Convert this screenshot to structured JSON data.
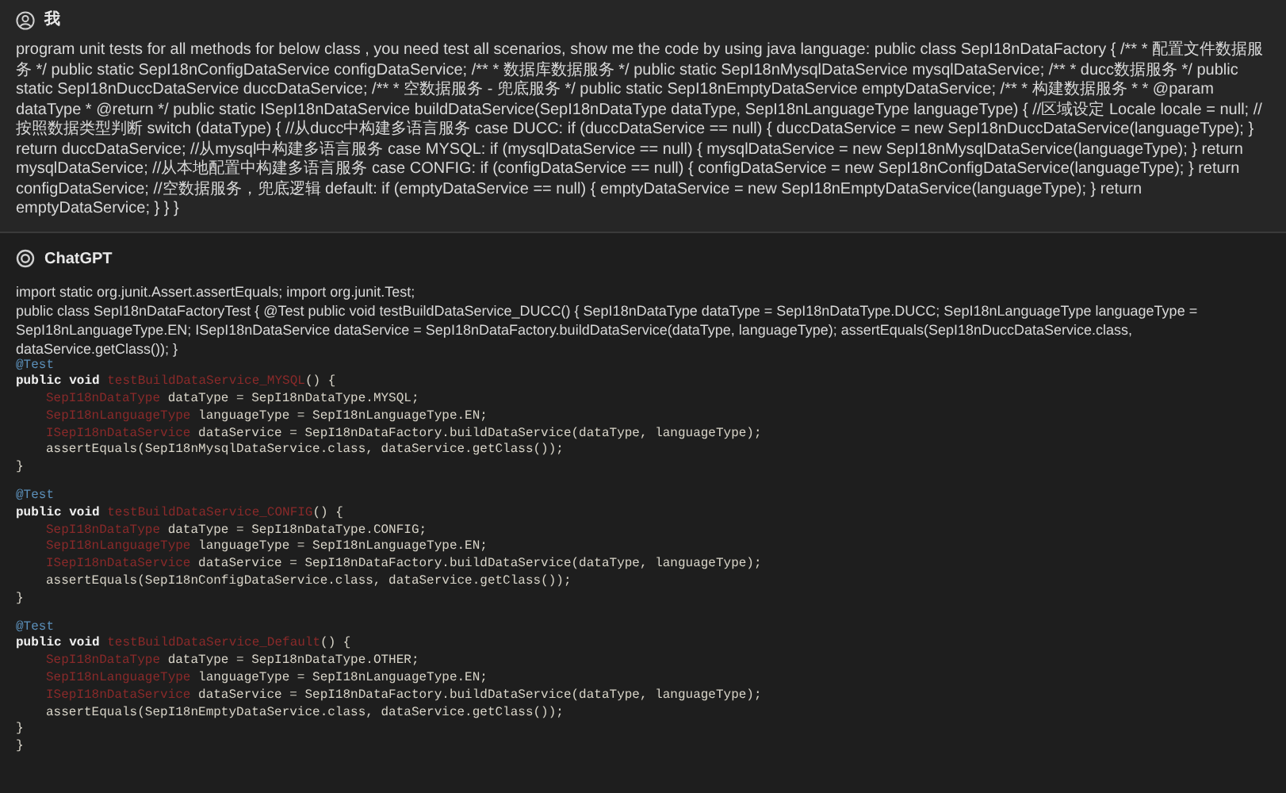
{
  "user_message": {
    "author": "我",
    "text": "program unit tests for all methods for below class , you need test all scenarios, show me the code by using java language: public class SepI18nDataFactory { /** * 配置文件数据服务 */ public static SepI18nConfigDataService configDataService; /** * 数据库数据服务 */ public static SepI18nMysqlDataService mysqlDataService; /** * ducc数据服务 */ public static SepI18nDuccDataService duccDataService; /** * 空数据服务 - 兜底服务 */ public static SepI18nEmptyDataService emptyDataService; /** * 构建数据服务 * * @param dataType * @return */ public static ISepI18nDataService buildDataService(SepI18nDataType dataType, SepI18nLanguageType languageType) { //区域设定 Locale locale = null; //按照数据类型判断 switch (dataType) { //从ducc中构建多语言服务 case DUCC: if (duccDataService == null) { duccDataService = new SepI18nDuccDataService(languageType); } return duccDataService; //从mysql中构建多语言服务 case MYSQL: if (mysqlDataService == null) { mysqlDataService = new SepI18nMysqlDataService(languageType); } return mysqlDataService; //从本地配置中构建多语言服务 case CONFIG: if (configDataService == null) { configDataService = new SepI18nConfigDataService(languageType); } return configDataService; //空数据服务，兜底逻辑 default: if (emptyDataService == null) { emptyDataService = new SepI18nEmptyDataService(languageType); } return emptyDataService; } } }"
  },
  "reply": {
    "author": "ChatGPT",
    "paragraphs": [
      "import static org.junit.Assert.assertEquals; import org.junit.Test;",
      "public class SepI18nDataFactoryTest { @Test public void testBuildDataService_DUCC() { SepI18nDataType dataType = SepI18nDataType.DUCC; SepI18nLanguageType languageType = SepI18nLanguageType.EN; ISepI18nDataService dataService = SepI18nDataFactory.buildDataService(dataType, languageType); assertEquals(SepI18nDuccDataService.class, dataService.getClass()); }"
    ],
    "code_blocks": [
      {
        "header": [
          [
            {
              "text": "@Test",
              "kind": "annotation"
            }
          ],
          [
            {
              "text": "public void ",
              "kind": "keyword"
            },
            {
              "text": "testBuildDataService_MYSQL",
              "kind": "error"
            },
            {
              "text": "() {",
              "kind": "plain"
            }
          ]
        ],
        "body": [
          [
            {
              "text": "SepI18nDataType",
              "kind": "error"
            },
            {
              "text": " dataType = SepI18nDataType.MYSQL;",
              "kind": "plain"
            }
          ],
          [
            {
              "text": "SepI18nLanguageType",
              "kind": "error"
            },
            {
              "text": " languageType = SepI18nLanguageType.EN;",
              "kind": "plain"
            }
          ],
          [
            {
              "text": "ISepI18nDataService",
              "kind": "error"
            },
            {
              "text": " dataService = SepI18nDataFactory.buildDataService(dataType, languageType);",
              "kind": "plain"
            }
          ],
          [
            {
              "text": "assertEquals(SepI18nMysqlDataService.class, dataService.getClass());",
              "kind": "plain"
            }
          ]
        ],
        "footer": [
          [
            {
              "text": "}",
              "kind": "plain"
            }
          ]
        ]
      },
      {
        "header": [
          [
            {
              "text": "@Test",
              "kind": "annotation"
            }
          ],
          [
            {
              "text": "public void ",
              "kind": "keyword"
            },
            {
              "text": "testBuildDataService_CONFIG",
              "kind": "error"
            },
            {
              "text": "() {",
              "kind": "plain"
            }
          ]
        ],
        "body": [
          [
            {
              "text": "SepI18nDataType",
              "kind": "error"
            },
            {
              "text": " dataType = SepI18nDataType.CONFIG;",
              "kind": "plain"
            }
          ],
          [
            {
              "text": "SepI18nLanguageType",
              "kind": "error"
            },
            {
              "text": " languageType = SepI18nLanguageType.EN;",
              "kind": "plain"
            }
          ],
          [
            {
              "text": "ISepI18nDataService",
              "kind": "error"
            },
            {
              "text": " dataService = SepI18nDataFactory.buildDataService(dataType, languageType);",
              "kind": "plain"
            }
          ],
          [
            {
              "text": "assertEquals(SepI18nConfigDataService.class, dataService.getClass());",
              "kind": "plain"
            }
          ]
        ],
        "footer": [
          [
            {
              "text": "}",
              "kind": "plain"
            }
          ]
        ]
      },
      {
        "header": [
          [
            {
              "text": "@Test",
              "kind": "annotation"
            }
          ],
          [
            {
              "text": "public void ",
              "kind": "keyword"
            },
            {
              "text": "testBuildDataService_Default",
              "kind": "error"
            },
            {
              "text": "() {",
              "kind": "plain"
            }
          ]
        ],
        "body": [
          [
            {
              "text": "SepI18nDataType",
              "kind": "error"
            },
            {
              "text": " dataType = SepI18nDataType.OTHER;",
              "kind": "plain"
            }
          ],
          [
            {
              "text": "SepI18nLanguageType",
              "kind": "error"
            },
            {
              "text": " languageType = SepI18nLanguageType.EN;",
              "kind": "plain"
            }
          ],
          [
            {
              "text": "ISepI18nDataService",
              "kind": "error"
            },
            {
              "text": " dataService = SepI18nDataFactory.buildDataService(dataType, languageType);",
              "kind": "plain"
            }
          ],
          [
            {
              "text": "assertEquals(SepI18nEmptyDataService.class, dataService.getClass());",
              "kind": "plain"
            }
          ]
        ],
        "footer": [
          [
            {
              "text": "}",
              "kind": "plain"
            }
          ],
          [
            {
              "text": "}",
              "kind": "plain"
            }
          ]
        ]
      }
    ]
  }
}
